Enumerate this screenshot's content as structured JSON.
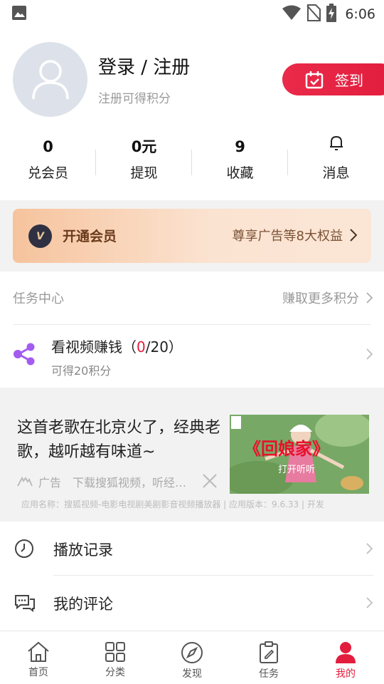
{
  "status_bar": {
    "time": "6:06"
  },
  "profile": {
    "title": "登录 / 注册",
    "subtitle": "注册可得积分",
    "signin_label": "签到",
    "stats": [
      {
        "value": "0",
        "label": "兑会员"
      },
      {
        "value": "0元",
        "label": "提现"
      },
      {
        "value": "9",
        "label": "收藏"
      },
      {
        "value": "",
        "label": "消息"
      }
    ]
  },
  "vip": {
    "badge": "V",
    "title": "开通会员",
    "promo": "尊享广告等8大权益"
  },
  "tasks": {
    "header": "任务中心",
    "more": "赚取更多积分",
    "item": {
      "title_prefix": "看视频赚钱（",
      "progress": "0",
      "title_suffix": "/20）",
      "subtitle": "可得20积分"
    }
  },
  "ad": {
    "text": "这首老歌在北京火了，经典老歌，越听越有味道~",
    "tag": "广告",
    "desc": "下载搜狐视频，听经…",
    "image_title": "《回娘家》",
    "image_caption": "打开听听",
    "footer": "应用名称：搜狐视频-电影电视剧美剧影音视频播放器 | 应用版本：9.6.33 | 开发"
  },
  "menu": [
    {
      "label": "播放记录"
    },
    {
      "label": "我的评论"
    }
  ],
  "tabbar": [
    {
      "label": "首页"
    },
    {
      "label": "分类"
    },
    {
      "label": "发现"
    },
    {
      "label": "任务"
    },
    {
      "label": "我的"
    }
  ],
  "colors": {
    "accent": "#e21d3d",
    "vip_text": "#6b3b1c"
  }
}
